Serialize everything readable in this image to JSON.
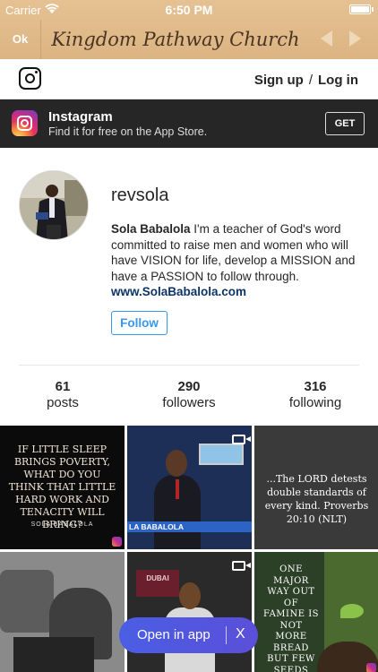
{
  "status": {
    "carrier": "Carrier",
    "time": "6:50 PM",
    "battery_level": 0.9
  },
  "nav": {
    "ok_label": "Ok",
    "title": "Kingdom Pathway Church"
  },
  "ig_header": {
    "signup": "Sign up",
    "separator": "/",
    "login": "Log in"
  },
  "banner": {
    "name": "Instagram",
    "subtitle": "Find it for free on the App Store.",
    "get_label": "GET"
  },
  "profile": {
    "username": "revsola",
    "bio_name": "Sola Babalola",
    "bio_text": " I'm a teacher of God's word committed to raise men and women who will have VISION for life, develop a MISSION and have a PASSION to follow through.",
    "website": "www.SolaBabalola.com",
    "follow_label": "Follow"
  },
  "stats": [
    {
      "num": "61",
      "label": "posts"
    },
    {
      "num": "290",
      "label": "followers"
    },
    {
      "num": "316",
      "label": "following"
    }
  ],
  "posts": {
    "p1_quote": "If little sleep brings poverty, what do you think that little hard work and tenacity will bring?",
    "p1_sig": "SOLA BABALOLA",
    "p2_caption": "LA BABALOLA",
    "p3_quote": "...The LORD detests double standards of every kind. Proverbs 20:10 (NLT)",
    "p5_sign": "DUBAI",
    "p6_quote": "One major way out of famine is not more bread but few seeds"
  },
  "open_app": {
    "label": "Open in app",
    "close": "X"
  },
  "colors": {
    "nav_bg": "#e0ba88",
    "banner_bg": "#262626",
    "follow_blue": "#3897f0",
    "link_navy": "#0c3566",
    "pill_bg": "#4a5ee4"
  }
}
